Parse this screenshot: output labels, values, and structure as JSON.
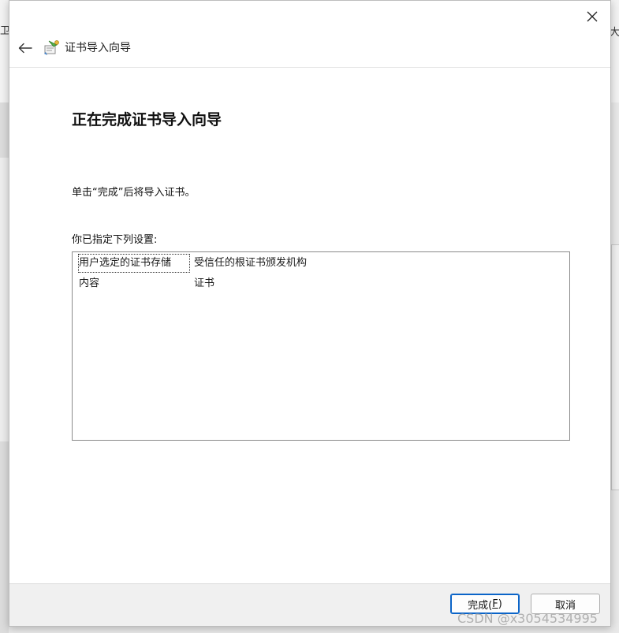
{
  "background": {
    "left_fragment": "卫",
    "right_fragment": "大"
  },
  "dialog": {
    "header_title": "证书导入向导",
    "main_title": "正在完成证书导入向导",
    "description": "单击“完成”后将导入证书。",
    "settings_label": "你已指定下列设置:",
    "settings": [
      {
        "key": "用户选定的证书存储",
        "value": "受信任的根证书颁发机构"
      },
      {
        "key": "内容",
        "value": "证书"
      }
    ],
    "buttons": {
      "finish_label": "完成(",
      "finish_mnemonic": "F",
      "finish_suffix": ")",
      "cancel_label": "取消"
    }
  },
  "watermark": "CSDN @x3054534995",
  "colors": {
    "accent": "#0a64c8",
    "footer_bg": "#f0f0f0"
  },
  "icons": [
    "close-icon",
    "back-arrow-icon",
    "certificate-wizard-icon"
  ]
}
